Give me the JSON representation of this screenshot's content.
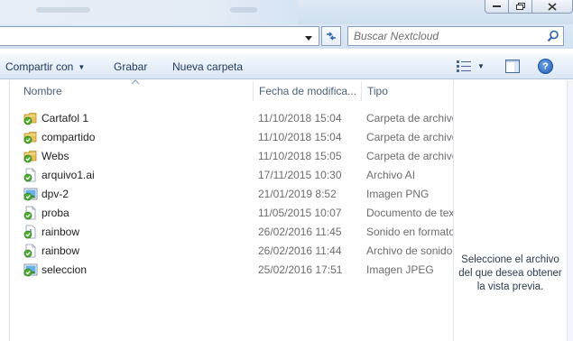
{
  "search": {
    "placeholder": "Buscar Nextcloud"
  },
  "toolbar": {
    "share_label": "Compartir con",
    "burn_label": "Grabar",
    "new_folder_label": "Nueva carpeta"
  },
  "columns": {
    "name": "Nombre",
    "date": "Fecha de modifica...",
    "type": "Tipo"
  },
  "files": [
    {
      "name": "Cartafol 1",
      "date": "11/10/2018 15:04",
      "type": "Carpeta de archivos",
      "icon": "folder-synced-icon"
    },
    {
      "name": "compartido",
      "date": "11/10/2018 15:04",
      "type": "Carpeta de archivos",
      "icon": "folder-synced-icon"
    },
    {
      "name": "Webs",
      "date": "11/10/2018 15:05",
      "type": "Carpeta de archivos",
      "icon": "folder-synced-icon"
    },
    {
      "name": "arquivo1.ai",
      "date": "17/11/2015 10:30",
      "type": "Archivo AI",
      "icon": "file-synced-icon"
    },
    {
      "name": "dpv-2",
      "date": "21/01/2019 8:52",
      "type": "Imagen PNG",
      "icon": "image-synced-icon"
    },
    {
      "name": "proba",
      "date": "11/05/2015 10:07",
      "type": "Documento de texto",
      "icon": "file-synced-icon"
    },
    {
      "name": "rainbow",
      "date": "26/02/2016 11:45",
      "type": "Sonido en formato",
      "icon": "audio-synced-icon"
    },
    {
      "name": "rainbow",
      "date": "26/02/2016 11:44",
      "type": "Archivo de sonido",
      "icon": "file-synced-icon"
    },
    {
      "name": "seleccion",
      "date": "25/02/2016 17:51",
      "type": "Imagen JPEG",
      "icon": "image-synced-icon"
    }
  ],
  "preview": {
    "line1": "Seleccione el archivo",
    "line2": "del que desea obtener",
    "line3": "la vista previa."
  },
  "colors": {
    "accent": "#1e395b",
    "folder": "#e8c15a",
    "sync_ok": "#4fae32",
    "muted_text": "#6d6d6d"
  }
}
